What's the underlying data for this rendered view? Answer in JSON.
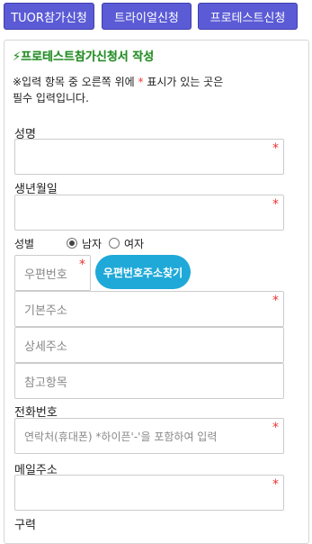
{
  "tabs": [
    {
      "label": "TUOR참가신청"
    },
    {
      "label": "트라이얼신청"
    },
    {
      "label": "프로테스트신청"
    }
  ],
  "form": {
    "title": "프로테스트참가신청서 작성",
    "title_icon": "lightning-icon",
    "notice_line1_a": "※입력 항목 중 오른쪽 위에 ",
    "notice_star": "*",
    "notice_line1_b": " 표시가 있는 곳은",
    "notice_line2": "필수 입력입니다.",
    "name": {
      "label": "성명",
      "value": ""
    },
    "birth": {
      "label": "생년월일",
      "value": ""
    },
    "gender": {
      "label": "성별",
      "options": [
        "남자",
        "여자"
      ],
      "selected": "남자"
    },
    "zipcode": {
      "placeholder": "우편번호"
    },
    "zip_search_button": "우편번호주소찾기",
    "address_basic": {
      "placeholder": "기본주소"
    },
    "address_detail": {
      "placeholder": "상세주소"
    },
    "address_ref": {
      "placeholder": "참고항목"
    },
    "phone": {
      "label": "전화번호",
      "placeholder": "연락처(휴대폰) *하이픈'-'을 포함하여 입력"
    },
    "email": {
      "label": "메일주소",
      "value": ""
    },
    "career": {
      "label": "구력"
    },
    "required_mark": "*"
  },
  "colors": {
    "tab_bg": "#5b5bd6",
    "title_green": "#2a8a2a",
    "required_red": "#ee3333",
    "zip_button": "#1fa9d8"
  }
}
